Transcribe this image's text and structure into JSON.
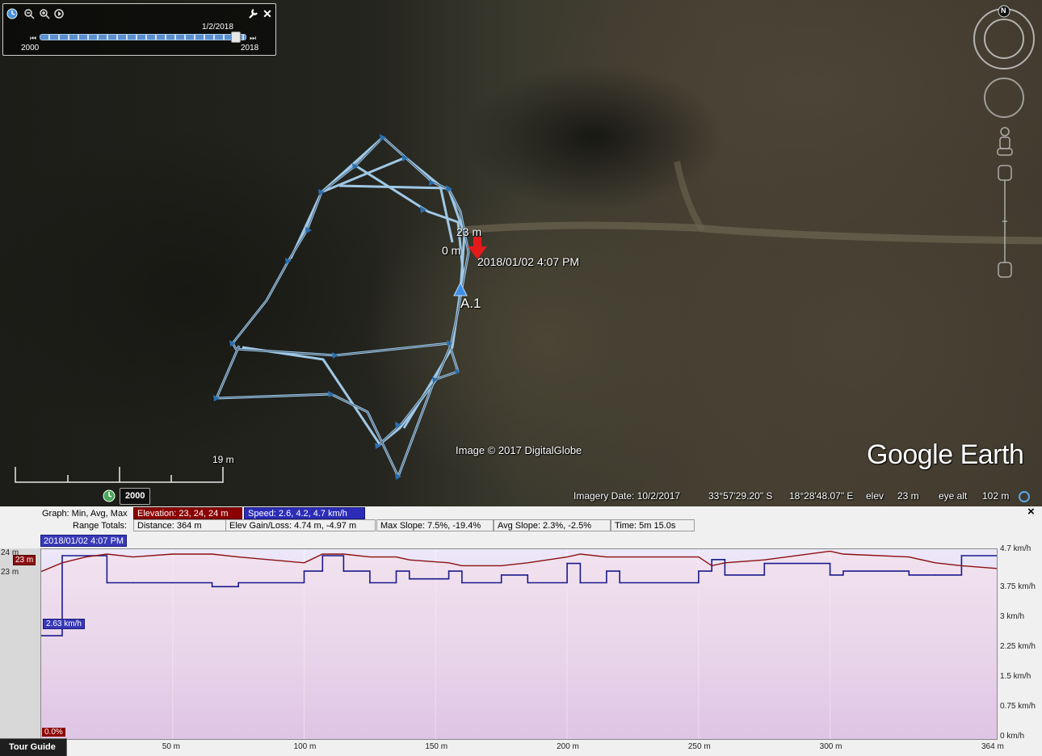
{
  "app": {
    "title": "Google Earth"
  },
  "time_slider": {
    "current_date": "1/2/2018",
    "start_label": "2000",
    "end_label": "2018",
    "position": 0.95
  },
  "map": {
    "track_start_label": "0 m",
    "track_end_label": "23 m",
    "marker_time": "2018/01/02 4:07 PM",
    "placemark_label": "A.1",
    "image_credit": "Image © 2017 DigitalGlobe",
    "watermark": "Google Earth",
    "scale_label": "19 m",
    "historical_year": "2000"
  },
  "nav": {
    "north": "N"
  },
  "status_bar": {
    "imagery_date": "Imagery Date: 10/2/2017",
    "latitude": "33°57'29.20\" S",
    "longitude": "18°28'48.07\" E",
    "elev_label": "elev",
    "elev_value": "23 m",
    "eye_alt_label": "eye alt",
    "eye_alt_value": "102 m"
  },
  "graph": {
    "graph_label": "Graph: Min, Avg, Max",
    "elevation_tag": "Elevation: 23, 24, 24 m",
    "speed_tag": "Speed: 2.6, 4.2, 4.7 km/h",
    "range_label": "Range Totals:",
    "distance": "Distance: 364 m",
    "elev_gain": "Elev Gain/Loss: 4.74 m, -4.97 m",
    "max_slope": "Max Slope: 7.5%, -19.4%",
    "avg_slope": "Avg Slope: 2.3%, -2.5%",
    "time": "Time: 5m 15.0s",
    "cursor_time": "2018/01/02 4:07 PM",
    "left_ticks": [
      "24 m",
      "23 m"
    ],
    "cursor_elev": "23 m",
    "cursor_speed": "2.63 km/h",
    "cursor_slope": "0.0%",
    "right_ticks": [
      "4.7 km/h",
      "3.75 km/h",
      "3 km/h",
      "2.25 km/h",
      "1.5 km/h",
      "0.75 km/h",
      "0 km/h"
    ],
    "x_ticks": [
      "50 m",
      "100 m",
      "150 m",
      "200 m",
      "250 m",
      "300 m",
      "364 m"
    ],
    "colors": {
      "elevation": "#8b1010",
      "speed": "#1a1a8c",
      "fill": "#c0a6e3"
    }
  },
  "chart_data": {
    "type": "line",
    "xlabel": "",
    "ylabel": "",
    "xlim": [
      0,
      364
    ],
    "x": [
      0,
      8,
      17,
      25,
      35,
      50,
      65,
      75,
      100,
      107,
      115,
      125,
      135,
      140,
      155,
      160,
      175,
      185,
      200,
      205,
      215,
      220,
      250,
      255,
      260,
      275,
      300,
      305,
      330,
      340,
      350,
      364
    ],
    "series": [
      {
        "name": "Speed",
        "unit": "km/h",
        "ylim": [
          0,
          4.7
        ],
        "values": [
          2.63,
          4.7,
          4.7,
          4.0,
          4.0,
          4.0,
          3.9,
          4.0,
          4.3,
          4.7,
          4.3,
          4.0,
          4.3,
          4.1,
          4.3,
          4.0,
          4.2,
          4.0,
          4.5,
          4.0,
          4.3,
          4.0,
          4.3,
          4.6,
          4.2,
          4.5,
          4.2,
          4.3,
          4.2,
          4.2,
          4.7,
          4.1
        ]
      },
      {
        "name": "Elevation",
        "unit": "m",
        "ylim": [
          23,
          24
        ],
        "values": [
          23.4,
          23.7,
          23.9,
          24.0,
          23.9,
          24.0,
          24.0,
          23.9,
          23.7,
          24.0,
          24.0,
          23.9,
          23.9,
          23.8,
          23.7,
          23.6,
          23.6,
          23.7,
          23.9,
          24.0,
          23.9,
          23.9,
          23.9,
          23.6,
          23.7,
          23.8,
          24.1,
          24.0,
          23.9,
          23.7,
          23.6,
          23.5
        ]
      }
    ]
  },
  "panel": {
    "close": "×",
    "tour_guide": "Tour Guide"
  }
}
